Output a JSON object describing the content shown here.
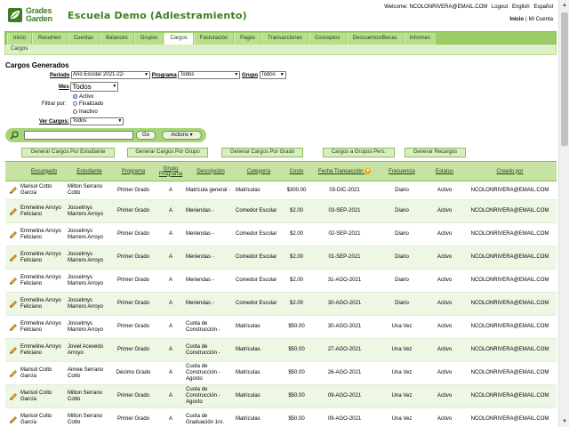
{
  "brand": {
    "logo_line1": "Grades",
    "logo_line2": "Garden",
    "school": "Escuela Demo (Adiestramiento)",
    "green": "#3d7f1f",
    "nav_green": "#9ccc65"
  },
  "topbar": {
    "welcome": "Welcome: NCOLONRIVERA@EMAIL.COM",
    "logout": "Logout",
    "english": "English",
    "espanol": "Español",
    "inicio": "Inicio",
    "sep": "|",
    "mi_cuenta": "Mi Cuenta"
  },
  "nav": {
    "tabs": [
      "Inicio",
      "Resumen",
      "Cuentas",
      "Balances",
      "Grupos",
      "Cargos",
      "Facturación",
      "Pagos",
      "Transacciones",
      "Conceptos",
      "Descuentos/Becas",
      "Informes"
    ],
    "active": "Cargos",
    "breadcrumb": "Cargos"
  },
  "page": {
    "title": "Cargos Generados"
  },
  "filters": {
    "periodo_label": "Periodo",
    "periodo_value": "Año Escolar 2021-22-",
    "programa_label": "Programa",
    "programa_value": "Todos",
    "grupo_label": "Grupo",
    "grupo_value": "Todos",
    "mes_label": "Mes",
    "mes_value": "Todos",
    "filtrar_label": "Filtrar por:",
    "radio_activo": "Activo",
    "radio_finalizado": "Finalizado",
    "radio_inactivo": "Inactivo",
    "ver_cargos_label": "Ver Cargos:",
    "ver_cargos_value": "Todos"
  },
  "search": {
    "go": "Go",
    "actions": "Actions"
  },
  "buttons": {
    "por_estudiante": "Generar Cargos Por Estudiante",
    "por_grupo": "Generar Cargos Por Grupo",
    "por_grado": "Generar Cargos Por Grado",
    "grupos_pers": "Cargos a Grupos Pers.",
    "recargos": "Generar Recargos"
  },
  "table": {
    "headers": {
      "encargado": "Encargado",
      "estudiante": "Estudiante",
      "programa": "Programa",
      "grupo": "Grupo Programa",
      "descripcion": "Descripción",
      "categoria": "Categoría",
      "costo": "Costo",
      "fecha": "Fecha Transacción",
      "frecuencia": "Frecuencia",
      "estatus": "Estatus",
      "creado": "Creado por"
    },
    "rows": [
      {
        "encargado": "Marisol Cotto García",
        "estudiante": "Milton Serrano Cotto",
        "programa": "Primer Grado",
        "grupo": "A",
        "descripcion": "Matrícula general -",
        "categoria": "Matrículas",
        "costo": "$300.00",
        "fecha": "03-DIC-2021",
        "frecuencia": "Diario",
        "estatus": "Activo",
        "creado": "NCOLONRIVERA@EMAIL.COM"
      },
      {
        "encargado": "Emmeline Arroyo Feliciano",
        "estudiante": "Josselmys Marrero Arroyo",
        "programa": "Primer Grado",
        "grupo": "A",
        "descripcion": "Meriendas -",
        "categoria": "Comedor Escolar",
        "costo": "$2.00",
        "fecha": "03-SEP-2021",
        "frecuencia": "Diario",
        "estatus": "Activo",
        "creado": "NCOLONRIVERA@EMAIL.COM"
      },
      {
        "encargado": "Emmeline Arroyo Feliciano",
        "estudiante": "Josselmys Marrero Arroyo",
        "programa": "Primer Grado",
        "grupo": "A",
        "descripcion": "Meriendas -",
        "categoria": "Comedor Escolar",
        "costo": "$2.00",
        "fecha": "02-SEP-2021",
        "frecuencia": "Diario",
        "estatus": "Activo",
        "creado": "NCOLONRIVERA@EMAIL.COM"
      },
      {
        "encargado": "Emmeline Arroyo Feliciano",
        "estudiante": "Josselmys Marrero Arroyo",
        "programa": "Primer Grado",
        "grupo": "A",
        "descripcion": "Meriendas -",
        "categoria": "Comedor Escolar",
        "costo": "$2.00",
        "fecha": "01-SEP-2021",
        "frecuencia": "Diario",
        "estatus": "Activo",
        "creado": "NCOLONRIVERA@EMAIL.COM"
      },
      {
        "encargado": "Emmeline Arroyo Feliciano",
        "estudiante": "Josselmys Marrero Arroyo",
        "programa": "Primer Grado",
        "grupo": "A",
        "descripcion": "Meriendas -",
        "categoria": "Comedor Escolar",
        "costo": "$2.00",
        "fecha": "31-AGO-2021",
        "frecuencia": "Diario",
        "estatus": "Activo",
        "creado": "NCOLONRIVERA@EMAIL.COM"
      },
      {
        "encargado": "Emmeline Arroyo Feliciano",
        "estudiante": "Josselmys Marrero Arroyo",
        "programa": "Primer Grado",
        "grupo": "A",
        "descripcion": "Meriendas -",
        "categoria": "Comedor Escolar",
        "costo": "$2.00",
        "fecha": "30-AGO-2021",
        "frecuencia": "Diario",
        "estatus": "Activo",
        "creado": "NCOLONRIVERA@EMAIL.COM"
      },
      {
        "encargado": "Emmeline Arroyo Feliciano",
        "estudiante": "Josselmys Marrero Arroyo",
        "programa": "Primer Grado",
        "grupo": "A",
        "descripcion": "Cuota de Construcción -",
        "categoria": "Matrículas",
        "costo": "$50.00",
        "fecha": "30-AGO-2021",
        "frecuencia": "Una Vez",
        "estatus": "Activo",
        "creado": "NCOLONRIVERA@EMAIL.COM"
      },
      {
        "encargado": "Emmeline Arroyo Feliciano",
        "estudiante": "Joviel Acevedo Arroyo",
        "programa": "Primer Grado",
        "grupo": "A",
        "descripcion": "Cuota de Construcción -",
        "categoria": "Matrículas",
        "costo": "$50.00",
        "fecha": "27-AGO-2021",
        "frecuencia": "Una Vez",
        "estatus": "Activo",
        "creado": "NCOLONRIVERA@EMAIL.COM"
      },
      {
        "encargado": "Marisol Cotto García",
        "estudiante": "Aimee Serrano Cotto",
        "programa": "Décimo Grado",
        "grupo": "A",
        "descripcion": "Cuota de Construcción - Agosto",
        "categoria": "Matrículas",
        "costo": "$50.00",
        "fecha": "26-AGO-2021",
        "frecuencia": "Una Vez",
        "estatus": "Activo",
        "creado": "NCOLONRIVERA@EMAIL.COM"
      },
      {
        "encargado": "Marisol Cotto García",
        "estudiante": "Milton Serrano Cotto",
        "programa": "Primer Grado",
        "grupo": "A",
        "descripcion": "Cuota de Construcción - Agosto",
        "categoria": "Matrículas",
        "costo": "$50.00",
        "fecha": "09-AGO-2021",
        "frecuencia": "Una Vez",
        "estatus": "Activo",
        "creado": "NCOLONRIVERA@EMAIL.COM"
      },
      {
        "encargado": "Marisol Cotto García",
        "estudiante": "Milton Serrano Cotto",
        "programa": "Primer Grado",
        "grupo": "A",
        "descripcion": "Cuota de Graduación 1ro.",
        "categoria": "Matrículas",
        "costo": "$50.00",
        "fecha": "09-AGO-2021",
        "frecuencia": "Una Vez",
        "estatus": "Activo",
        "creado": "NCOLONRIVERA@EMAIL.COM"
      }
    ]
  }
}
